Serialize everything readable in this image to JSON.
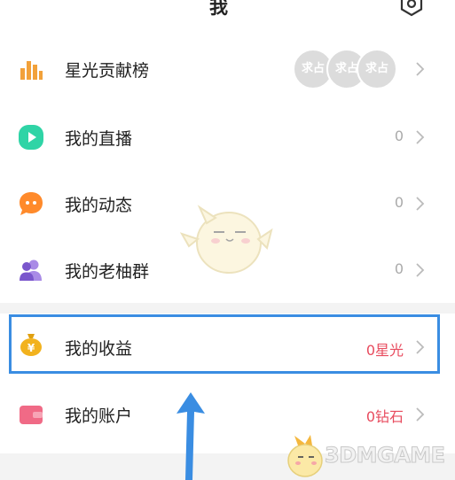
{
  "header": {
    "title": "我",
    "settings_icon": "settings-hexagon-icon"
  },
  "menu": [
    {
      "id": "contribution",
      "label": "星光贡献榜",
      "value": "",
      "icon": "bar-chart-icon",
      "icon_color": "#f2a13a"
    },
    {
      "id": "live",
      "label": "我的直播",
      "value": "0",
      "icon": "play-icon",
      "icon_color": "#2fd4a6"
    },
    {
      "id": "moments",
      "label": "我的动态",
      "value": "0",
      "icon": "chat-bubble-icon",
      "icon_color": "#ff8a2b"
    },
    {
      "id": "group",
      "label": "我的老柚群",
      "value": "0",
      "icon": "group-icon",
      "icon_color": "#8c6bd6"
    },
    {
      "id": "earnings",
      "label": "我的收益",
      "value": "0星光",
      "icon": "money-bag-icon",
      "icon_color": "#f2b21e"
    },
    {
      "id": "account",
      "label": "我的账户",
      "value": "0钻石",
      "icon": "wallet-icon",
      "icon_color": "#f06a86"
    }
  ],
  "contributors": [
    {
      "text": "求占"
    },
    {
      "text": "求占"
    },
    {
      "text": "求占"
    }
  ],
  "colors": {
    "accent_red": "#e84b5e",
    "highlight_blue": "#3a8de2"
  },
  "watermark": {
    "text": "3DMGAME"
  }
}
